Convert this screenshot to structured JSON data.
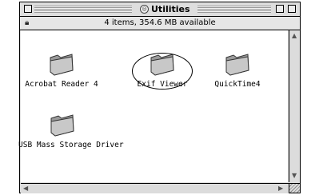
{
  "window": {
    "title": "Utilities",
    "info": "4 items, 354.6 MB available",
    "title_icon": "disk-icon",
    "lock_icon": "lock-icon"
  },
  "items": [
    {
      "label": "Acrobat Reader 4",
      "icon": "folder-icon"
    },
    {
      "label": "Exif Viewer",
      "icon": "folder-icon"
    },
    {
      "label": "QuickTime4",
      "icon": "folder-icon"
    },
    {
      "label": "USB Mass Storage Driver",
      "icon": "folder-icon"
    }
  ],
  "annotations": {
    "highlighted_item": "Exif Viewer"
  }
}
